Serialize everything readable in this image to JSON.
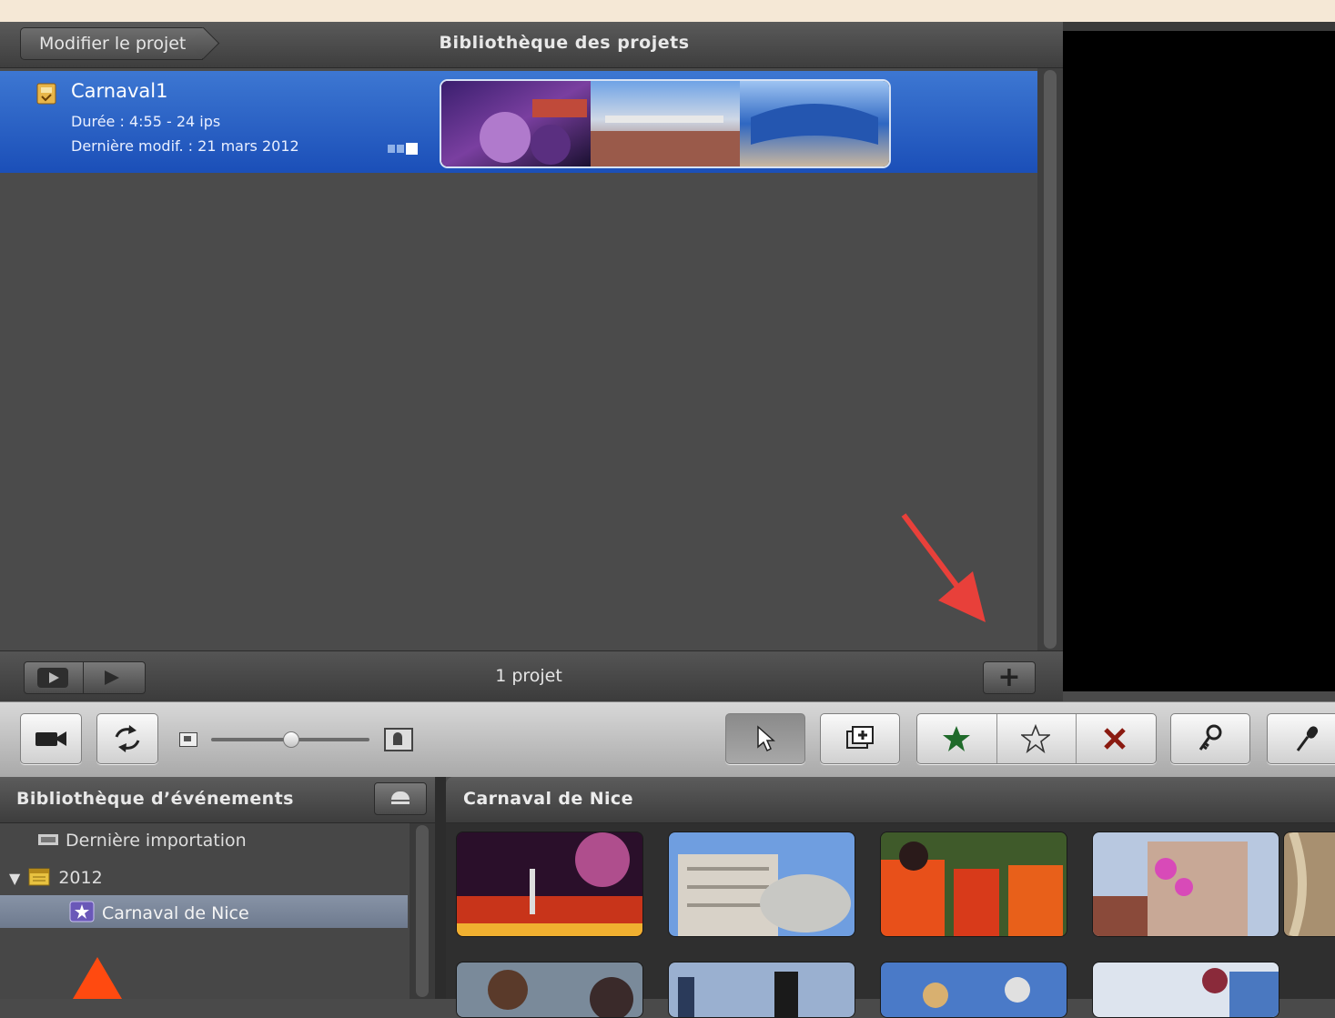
{
  "project_library": {
    "back_button": "Modifier le projet",
    "title": "Bibliothèque des projets",
    "project": {
      "name": "Carnaval1",
      "duration": "Durée : 4:55 - 24 ips",
      "modified": "Dernière modif. : 21 mars 2012"
    },
    "count": "1 projet",
    "add_button": "+"
  },
  "toolbar": {
    "buttons": [
      "camera-icon",
      "swap-icon",
      "pointer-icon",
      "add-clip-icon",
      "favorite-star-icon",
      "unmark-star-icon",
      "reject-x-icon",
      "keyword-icon",
      "voiceover-mic-icon"
    ],
    "thumbnail_size": 0.5
  },
  "event_library": {
    "title": "Bibliothèque d’événements",
    "items": [
      "Dernière importation",
      "2012",
      "Carnaval de Nice"
    ]
  },
  "event_browser": {
    "title": "Carnaval de Nice"
  },
  "colors": {
    "selection_blue": "#2a62c6",
    "annotation_red": "#e8403a",
    "annotation_orange": "#ff4a10"
  }
}
